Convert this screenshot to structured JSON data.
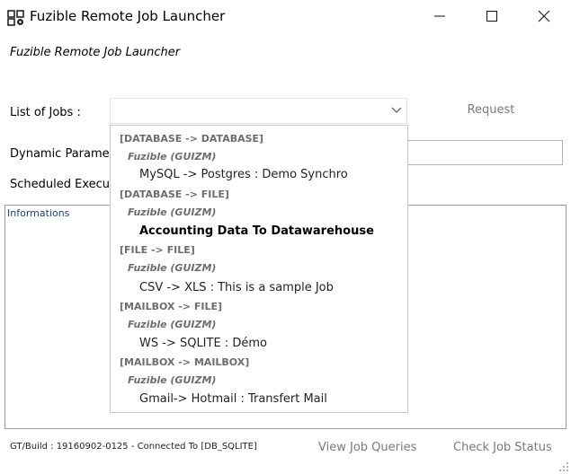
{
  "window": {
    "title": "Fuzible Remote Job Launcher"
  },
  "header": {
    "subtitle": "Fuzible Remote Job Launcher"
  },
  "form": {
    "jobs_label": "List of Jobs :",
    "dynamic_label": "Dynamic Paramete",
    "scheduled_label": "Scheduled Executio",
    "request_label": "Request",
    "selected_job": ""
  },
  "dropdown": {
    "groups": [
      {
        "name": "[DATABASE -> DATABASE]",
        "owner": "Fuzible (GUIZM)",
        "job": "MySQL -> Postgres : Demo Synchro"
      },
      {
        "name": "[DATABASE -> FILE]",
        "owner": "Fuzible (GUIZM)",
        "job": "Accounting Data To Datawarehouse"
      },
      {
        "name": "[FILE -> FILE]",
        "owner": "Fuzible (GUIZM)",
        "job": "CSV -> XLS : This is a sample Job"
      },
      {
        "name": "[MAILBOX -> FILE]",
        "owner": "Fuzible (GUIZM)",
        "job": "WS -> SQLITE : Démo"
      },
      {
        "name": "[MAILBOX -> MAILBOX]",
        "owner": "Fuzible (GUIZM)",
        "job": "Gmail-> Hotmail : Transfert Mail"
      }
    ],
    "highlighted_job": "Accounting Data To Datawarehouse"
  },
  "info": {
    "label": "Informations"
  },
  "footer": {
    "status": "GT/Build : 19160902-0125 - Connected To [DB_SQLITE]",
    "view_queries": "View Job Queries",
    "check_status": "Check Job Status"
  },
  "icons": {
    "app": "app-gear-icon",
    "combo_arrow": "chevron-down-icon",
    "minimize": "minimize-icon",
    "maximize": "maximize-icon",
    "close": "close-icon",
    "resize": "resize-grip-icon"
  }
}
